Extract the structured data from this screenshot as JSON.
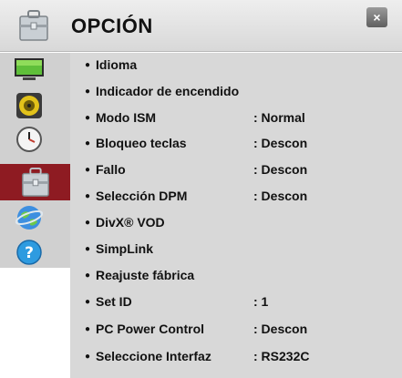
{
  "header": {
    "title": "OPCIÓN",
    "close_label": "×",
    "icon": "toolbox-icon"
  },
  "sidebar": {
    "items": [
      {
        "name": "picture",
        "icon": "tv-icon"
      },
      {
        "name": "audio",
        "icon": "speaker-icon"
      },
      {
        "name": "time",
        "icon": "clock-icon"
      },
      {
        "name": "option",
        "icon": "toolbox-icon",
        "active": true
      },
      {
        "name": "network",
        "icon": "globe-icon"
      },
      {
        "name": "support",
        "icon": "help-icon"
      }
    ]
  },
  "menu": {
    "bullet": "●",
    "items": [
      {
        "label": "Idioma",
        "value": ""
      },
      {
        "label": "Indicador de encendido",
        "value": ""
      },
      {
        "label": "Modo ISM",
        "value": ": Normal"
      },
      {
        "label": "Bloqueo teclas",
        "value": ": Descon"
      },
      {
        "label": "Fallo",
        "value": ": Descon"
      },
      {
        "label": "Selección DPM",
        "value": ": Descon"
      },
      {
        "label": "DivX® VOD",
        "value": ""
      },
      {
        "label": "SimpLink",
        "value": ""
      },
      {
        "label": "Reajuste fábrica",
        "value": ""
      },
      {
        "label": "Set ID",
        "value": ": 1"
      },
      {
        "label": "PC Power Control",
        "value": ": Descon"
      },
      {
        "label": "Seleccione Interfaz",
        "value": ": RS232C"
      }
    ]
  },
  "colors": {
    "active_sidebar": "#8e1b22",
    "panel": "#d8d8d8",
    "sidebar": "#d0d0d0"
  }
}
